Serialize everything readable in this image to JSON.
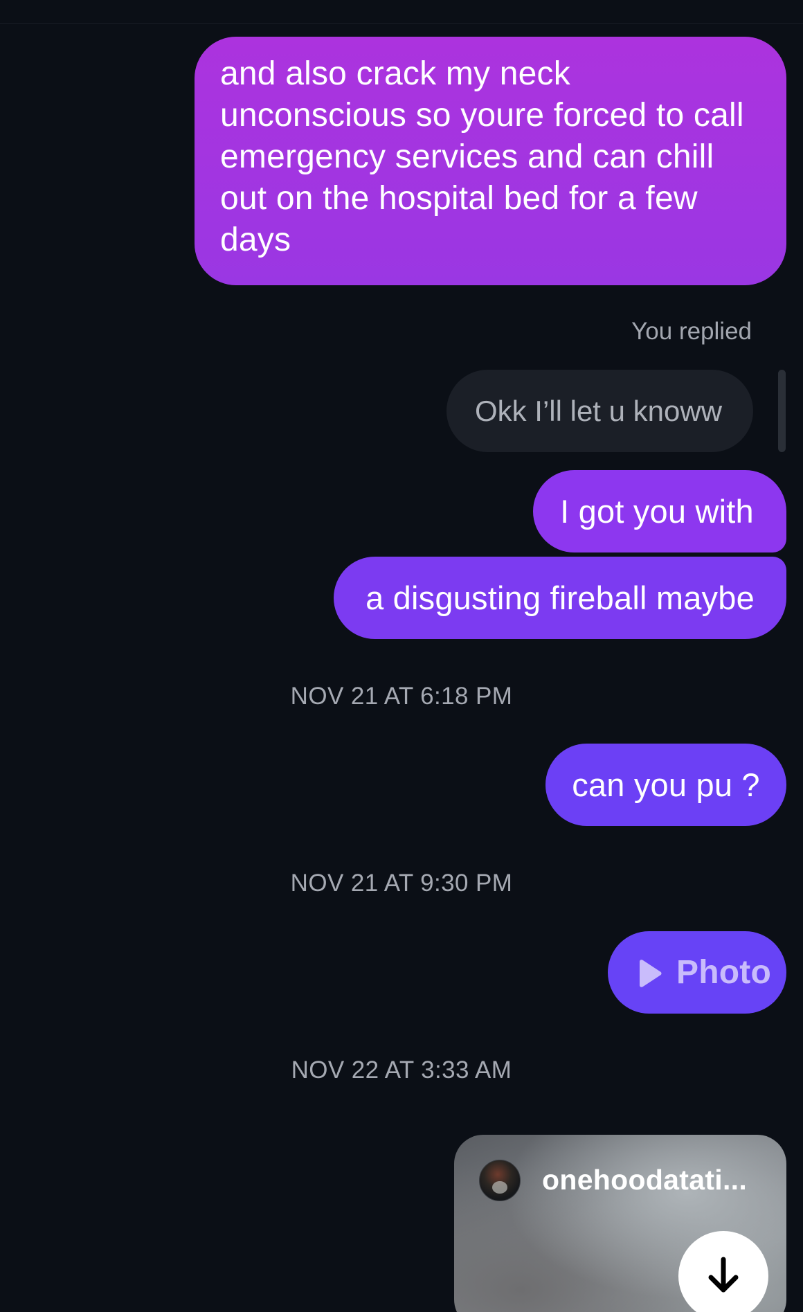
{
  "messages": {
    "msg1_lines": [
      "and also crack my neck",
      "unconscious so youre forced to call",
      "emergency services and can chill",
      "out on the hospital bed for a few",
      "days"
    ],
    "reply_label": "You replied",
    "replied_to_text": "Okk I’ll let u knoww",
    "msg2": "I got you with",
    "msg3": "a disgusting fireball maybe",
    "timestamp1": "NOV 21 AT 6:18 PM",
    "msg4": "can you pu ?",
    "timestamp2": "NOV 21 AT 9:30 PM",
    "msg5_photo_label": "Photo",
    "timestamp3": "NOV 22 AT 3:33 AM",
    "shared_reel_username": "onehoodatati..."
  },
  "icons": {
    "play": "play-icon",
    "download": "download-arrow-icon"
  },
  "colors": {
    "background": "#0b0f16",
    "bubble_top": "#ac33de",
    "bubble_bottom": "#6743f6",
    "reply_bubble": "#1b1f27",
    "timestamp_text": "#a5a9b2"
  }
}
